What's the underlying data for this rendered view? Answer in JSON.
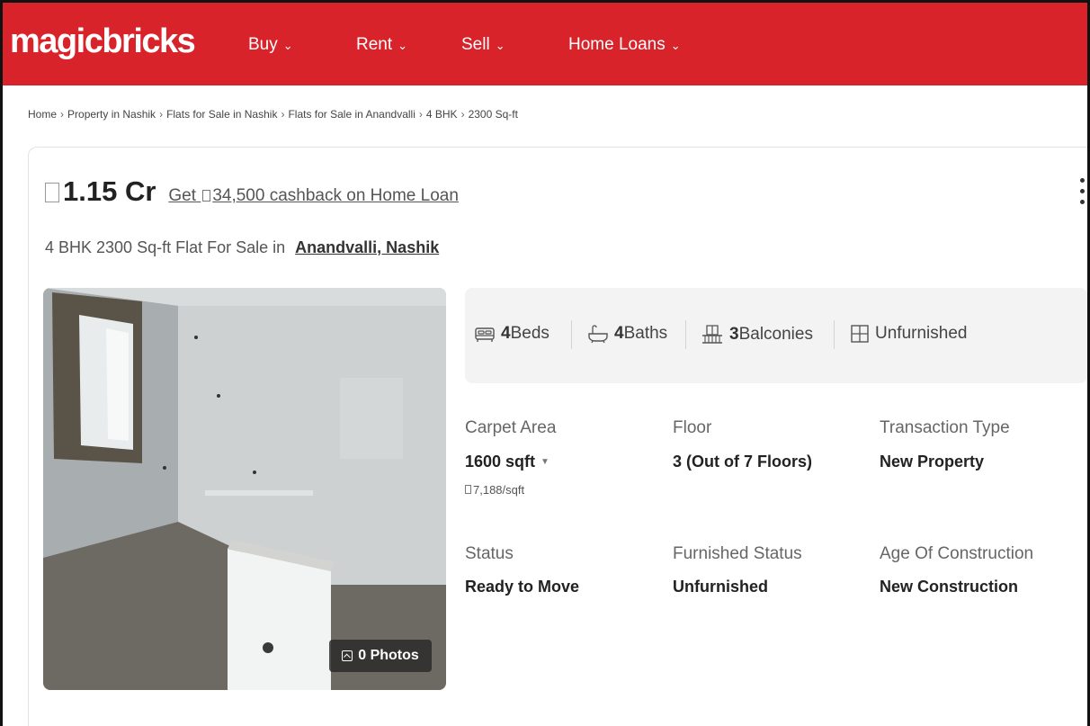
{
  "header": {
    "logo": "magicbricks",
    "nav": [
      {
        "label": "Buy"
      },
      {
        "label": "Rent"
      },
      {
        "label": "Sell"
      },
      {
        "label": "Home Loans"
      }
    ],
    "brand_color": "#d8232a"
  },
  "breadcrumb": [
    "Home",
    "Property in Nashik",
    "Flats for Sale in Nashik",
    "Flats for Sale in Anandvalli",
    "4 BHK",
    "2300 Sq-ft"
  ],
  "listing": {
    "price": "1.15 Cr",
    "cashback_prefix": "Get",
    "cashback_text": "34,500 cashback on Home Loan",
    "title": "4 BHK 2300 Sq-ft Flat For Sale in",
    "location": "Anandvalli, Nashik",
    "photos_label": "0 Photos"
  },
  "amenities": [
    {
      "icon": "bed-icon",
      "count": "4",
      "label": "Beds"
    },
    {
      "icon": "bath-icon",
      "count": "4",
      "label": "Baths"
    },
    {
      "icon": "balcony-icon",
      "count": "3",
      "label": "Balconies"
    },
    {
      "icon": "furnishing-icon",
      "count": "",
      "label": "Unfurnished"
    }
  ],
  "details": {
    "carpet_area": {
      "label": "Carpet Area",
      "value": "1600 sqft",
      "sub": "7,188/sqft"
    },
    "floor": {
      "label": "Floor",
      "value": "3 (Out of 7 Floors)"
    },
    "transaction_type": {
      "label": "Transaction Type",
      "value": "New Property"
    },
    "status": {
      "label": "Status",
      "value": "Ready to Move"
    },
    "furnished_status": {
      "label": "Furnished Status",
      "value": "Unfurnished"
    },
    "age_of_construction": {
      "label": "Age Of Construction",
      "value": "New Construction"
    }
  }
}
